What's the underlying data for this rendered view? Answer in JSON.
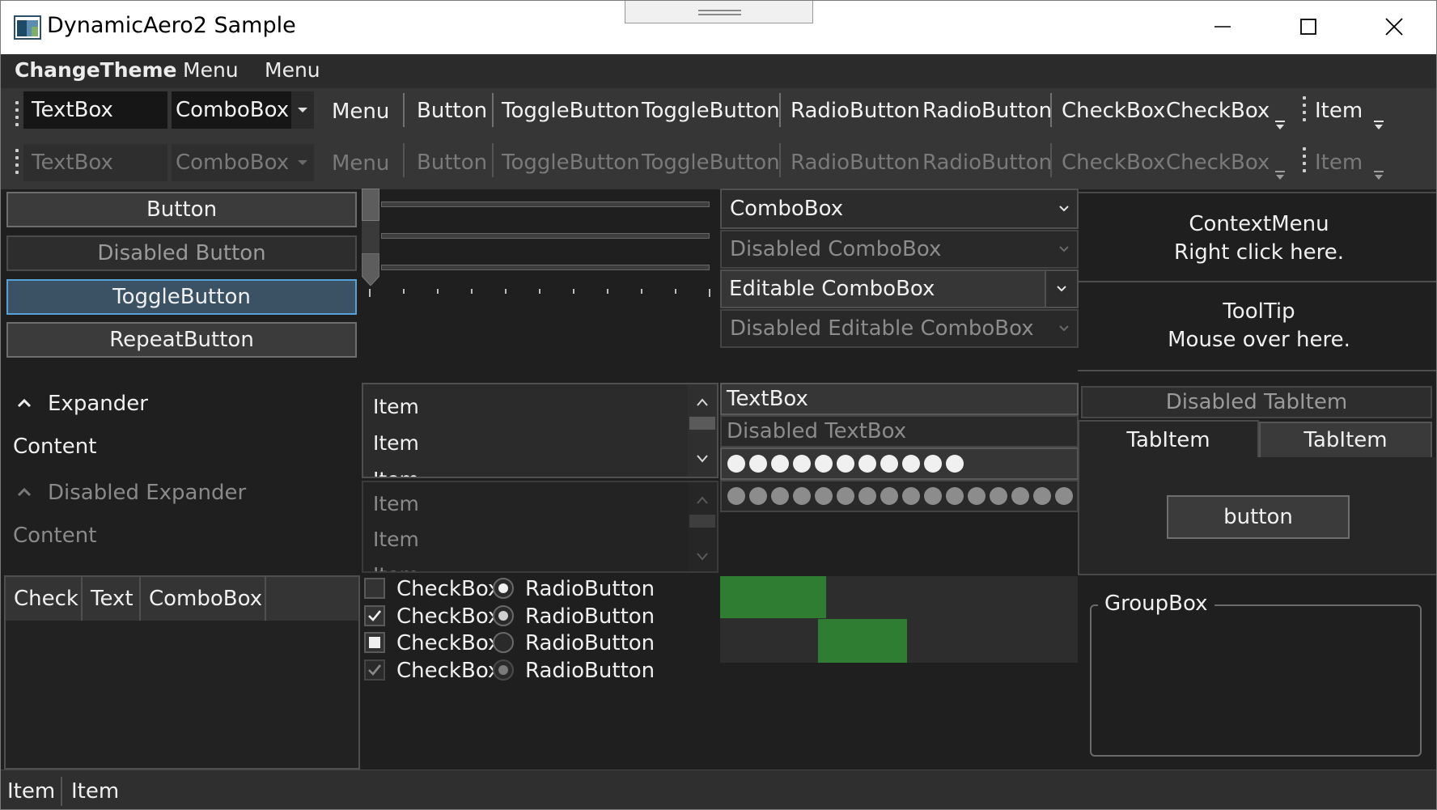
{
  "window": {
    "title": "DynamicAero2 Sample",
    "caption_buttons": [
      "minimize-icon",
      "maximize-icon",
      "close-icon"
    ]
  },
  "menubar": {
    "items": [
      "ChangeTheme",
      "Menu",
      "Menu"
    ]
  },
  "toolbar": {
    "textbox": "TextBox",
    "combobox": "ComboBox",
    "menu": "Menu",
    "button": "Button",
    "toggle1": "ToggleButton",
    "toggle2": "ToggleButton",
    "radio1": "RadioButton",
    "radio2": "RadioButton",
    "check1": "CheckBox",
    "check2": "CheckBox",
    "item": "Item"
  },
  "buttons": {
    "button": "Button",
    "disabled": "Disabled Button",
    "toggle": "ToggleButton",
    "repeat": "RepeatButton"
  },
  "slider": {
    "vertical_value": 0,
    "horizontal_values": [
      0,
      0,
      0
    ]
  },
  "combos": {
    "normal": "ComboBox",
    "disabled": "Disabled ComboBox",
    "editable": "Editable ComboBox",
    "disabled_editable": "Disabled Editable ComboBox"
  },
  "context": {
    "menu_line1": "ContextMenu",
    "menu_line2": "Right click here.",
    "tooltip_line1": "ToolTip",
    "tooltip_line2": "Mouse over here."
  },
  "expander": {
    "header": "Expander",
    "content": "Content",
    "disabled_header": "Disabled Expander",
    "disabled_content": "Content"
  },
  "listbox": {
    "items": [
      "Item",
      "Item",
      "Item"
    ]
  },
  "disabled_listbox": {
    "items": [
      "Item",
      "Item",
      "Item"
    ]
  },
  "textboxes": {
    "normal": "TextBox",
    "disabled": "Disabled TextBox",
    "password_length": 11,
    "disabled_password_length": 16
  },
  "tabs": {
    "disabled": "Disabled TabItem",
    "tab1": "TabItem",
    "tab2": "TabItem",
    "content_button": "button"
  },
  "datagrid": {
    "columns": [
      "Check",
      "Text",
      "ComboBox"
    ]
  },
  "checks": {
    "labels": [
      "CheckBox",
      "CheckBox",
      "CheckBox",
      "CheckBox"
    ],
    "states": [
      "unchecked",
      "checked",
      "indeterminate",
      "checked-disabled"
    ]
  },
  "radios": {
    "labels": [
      "RadioButton",
      "RadioButton",
      "RadioButton",
      "RadioButton"
    ],
    "states": [
      "checked",
      "checked",
      "unchecked",
      "checked-disabled"
    ]
  },
  "groupbox": {
    "header": "GroupBox"
  },
  "statusbar": {
    "items": [
      "Item",
      "Item"
    ]
  },
  "colors": {
    "window_bg": "#1f1f1f",
    "menubar_bg": "#2b2b2b",
    "toolbar_bg": "#363636",
    "accent": "#57a1d8",
    "progress_green": "#2e7d32"
  }
}
